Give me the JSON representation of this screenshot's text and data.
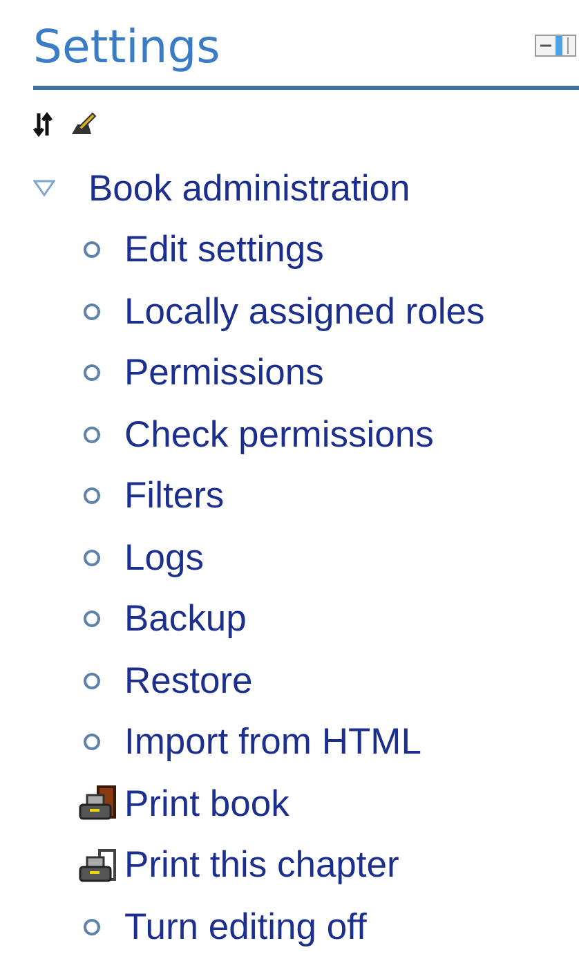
{
  "block": {
    "title": "Settings",
    "collapsed": false
  },
  "section": {
    "label": "Book administration",
    "expanded": true,
    "items": [
      {
        "kind": "bullet",
        "label": "Edit settings"
      },
      {
        "kind": "bullet",
        "label": "Locally assigned roles"
      },
      {
        "kind": "bullet",
        "label": "Permissions"
      },
      {
        "kind": "bullet",
        "label": "Check permissions"
      },
      {
        "kind": "bullet",
        "label": "Filters"
      },
      {
        "kind": "bullet",
        "label": "Logs"
      },
      {
        "kind": "bullet",
        "label": "Backup"
      },
      {
        "kind": "bullet",
        "label": "Restore"
      },
      {
        "kind": "bullet",
        "label": "Import from HTML"
      },
      {
        "kind": "print-book",
        "label": "Print book"
      },
      {
        "kind": "print-page",
        "label": "Print this chapter"
      },
      {
        "kind": "bullet",
        "label": "Turn editing off"
      }
    ]
  }
}
